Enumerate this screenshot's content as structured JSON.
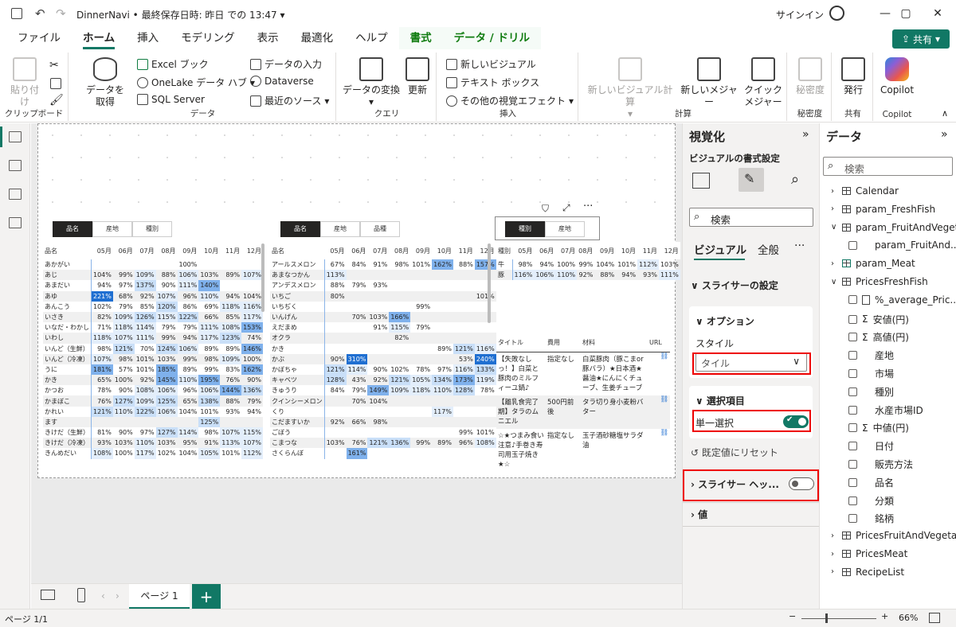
{
  "window": {
    "title": "DinnerNavi • 最終保存日時: 昨日 での 13:47 ▾",
    "signin": "サインイン"
  },
  "tabs": [
    "ファイル",
    "ホーム",
    "挿入",
    "モデリング",
    "表示",
    "最適化",
    "ヘルプ",
    "書式",
    "データ / ドリル"
  ],
  "share": "共有",
  "ribbon": {
    "clipboard": {
      "paste": "貼り付け",
      "label": "クリップボード"
    },
    "data": {
      "get": "データを\n取得",
      "excel": "Excel ブック",
      "onelake": "OneLake データ ハブ",
      "sql": "SQL Server",
      "enter": "データの入力",
      "dataverse": "Dataverse",
      "recent": "最近のソース",
      "label": "データ"
    },
    "query": {
      "transform": "データの変換",
      "refresh": "更新",
      "label": "クエリ"
    },
    "insert": {
      "newvisual": "新しいビジュアル",
      "textbox": "テキスト ボックス",
      "more": "その他の視覚エフェクト",
      "label": "挿入"
    },
    "calc": {
      "visualcalc": "新しいビジュアル計算",
      "newmeasure": "新しいメジャー",
      "quick": "クイック\nメジャー",
      "label": "計算"
    },
    "sensitivity": {
      "btn": "秘密度",
      "label": "秘密度"
    },
    "share": {
      "publish": "発行",
      "label": "共有"
    },
    "copilot": {
      "btn": "Copilot",
      "label": "Copilot"
    }
  },
  "table1": {
    "slicer": [
      "品名",
      "産地",
      "種別"
    ],
    "header": [
      "品名",
      "05月",
      "06月",
      "07月",
      "08月",
      "09月",
      "10月",
      "11月",
      "12月"
    ],
    "rows": [
      [
        "あかがい",
        "",
        "",
        "",
        "",
        "100%",
        "",
        "",
        ""
      ],
      [
        "あじ",
        "104%",
        "99%",
        "109%",
        "88%",
        "106%",
        "103%",
        "89%",
        "107%"
      ],
      [
        "あまだい",
        "94%",
        "97%",
        "137%",
        "90%",
        "111%",
        "140%",
        "",
        ""
      ],
      [
        "あゆ",
        "221%",
        "68%",
        "92%",
        "107%",
        "96%",
        "110%",
        "94%",
        "104%"
      ],
      [
        "あんこう",
        "102%",
        "79%",
        "85%",
        "120%",
        "86%",
        "69%",
        "118%",
        "116%"
      ],
      [
        "いさき",
        "82%",
        "109%",
        "126%",
        "115%",
        "122%",
        "66%",
        "85%",
        "117%"
      ],
      [
        "いなだ・わかし",
        "71%",
        "118%",
        "114%",
        "79%",
        "79%",
        "111%",
        "108%",
        "153%"
      ],
      [
        "いわし",
        "118%",
        "107%",
        "111%",
        "99%",
        "94%",
        "117%",
        "123%",
        "74%"
      ],
      [
        "いんど（生鮮）",
        "98%",
        "121%",
        "70%",
        "124%",
        "106%",
        "89%",
        "89%",
        "146%"
      ],
      [
        "いんど（冷凍）",
        "107%",
        "98%",
        "101%",
        "103%",
        "99%",
        "98%",
        "109%",
        "100%"
      ],
      [
        "うに",
        "181%",
        "57%",
        "101%",
        "185%",
        "89%",
        "99%",
        "83%",
        "162%"
      ],
      [
        "かき",
        "65%",
        "100%",
        "92%",
        "145%",
        "110%",
        "195%",
        "76%",
        "90%"
      ],
      [
        "かつお",
        "78%",
        "90%",
        "108%",
        "106%",
        "96%",
        "106%",
        "144%",
        "136%"
      ],
      [
        "かまぼこ",
        "76%",
        "127%",
        "109%",
        "125%",
        "65%",
        "138%",
        "88%",
        "79%"
      ],
      [
        "かれい",
        "121%",
        "110%",
        "122%",
        "106%",
        "104%",
        "101%",
        "93%",
        "94%"
      ],
      [
        "ます",
        "",
        "",
        "",
        "",
        "",
        "125%",
        "",
        ""
      ],
      [
        "きけだ（生鮮）",
        "81%",
        "90%",
        "97%",
        "127%",
        "114%",
        "98%",
        "107%",
        "115%"
      ],
      [
        "きけだ（冷凍）",
        "93%",
        "103%",
        "110%",
        "103%",
        "95%",
        "91%",
        "113%",
        "107%"
      ],
      [
        "きんめだい",
        "108%",
        "100%",
        "117%",
        "102%",
        "104%",
        "105%",
        "101%",
        "112%"
      ]
    ]
  },
  "table2": {
    "slicer": [
      "品名",
      "産地",
      "品種"
    ],
    "header": [
      "品名",
      "05月",
      "06月",
      "07月",
      "08月",
      "09月",
      "10月",
      "11月",
      "12月"
    ],
    "rows": [
      [
        "アールスメロン",
        "67%",
        "84%",
        "91%",
        "98%",
        "101%",
        "162%",
        "88%",
        "157%"
      ],
      [
        "あまなつかん",
        "113%",
        "",
        "",
        "",
        "",
        "",
        "",
        ""
      ],
      [
        "アンデスメロン",
        "88%",
        "79%",
        "93%",
        "",
        "",
        "",
        "",
        ""
      ],
      [
        "いちご",
        "80%",
        "",
        "",
        "",
        "",
        "",
        "",
        "101%"
      ],
      [
        "いちぢく",
        "",
        "",
        "",
        "",
        "99%",
        "",
        "",
        ""
      ],
      [
        "いんげん",
        "",
        "70%",
        "103%",
        "166%",
        "",
        "",
        "",
        ""
      ],
      [
        "えだまめ",
        "",
        "",
        "91%",
        "115%",
        "79%",
        "",
        "",
        ""
      ],
      [
        "オクラ",
        "",
        "",
        "",
        "82%",
        "",
        "",
        "",
        ""
      ],
      [
        "かき",
        "",
        "",
        "",
        "",
        "",
        "89%",
        "121%",
        "116%"
      ],
      [
        "かぶ",
        "90%",
        "310%",
        "",
        "",
        "",
        "",
        "53%",
        "240%"
      ],
      [
        "かぼちゃ",
        "121%",
        "114%",
        "90%",
        "102%",
        "78%",
        "97%",
        "116%",
        "133%"
      ],
      [
        "キャベツ",
        "128%",
        "43%",
        "92%",
        "121%",
        "105%",
        "134%",
        "173%",
        "119%"
      ],
      [
        "きゅうり",
        "84%",
        "79%",
        "149%",
        "109%",
        "118%",
        "110%",
        "128%",
        "78%"
      ],
      [
        "クインシーメロン",
        "",
        "70%",
        "104%",
        "",
        "",
        "",
        "",
        ""
      ],
      [
        "くり",
        "",
        "",
        "",
        "",
        "",
        "117%",
        "",
        ""
      ],
      [
        "こだますいか",
        "92%",
        "66%",
        "98%",
        "",
        "",
        "",
        "",
        ""
      ],
      [
        "ごぼう",
        "",
        "",
        "",
        "",
        "",
        "",
        "99%",
        "101%"
      ],
      [
        "こまつな",
        "103%",
        "76%",
        "121%",
        "136%",
        "99%",
        "89%",
        "96%",
        "108%"
      ],
      [
        "さくらんぼ",
        "",
        "161%",
        "",
        "",
        "",
        "",
        "",
        ""
      ]
    ]
  },
  "table3": {
    "slicer": [
      "種別",
      "産地"
    ],
    "header": [
      "種別",
      "05月",
      "06月",
      "07月",
      "08月",
      "09月",
      "10月",
      "11月",
      "12月"
    ],
    "rows": [
      [
        "牛",
        "98%",
        "94%",
        "100%",
        "99%",
        "104%",
        "101%",
        "112%",
        "103%"
      ],
      [
        "豚",
        "116%",
        "106%",
        "110%",
        "92%",
        "88%",
        "94%",
        "93%",
        "111%"
      ]
    ]
  },
  "recipes": {
    "header": [
      "タイトル",
      "費用",
      "材料",
      "URL"
    ],
    "rows": [
      [
        "【失敗なしっ！】白菜と豚肉のミルフィーユ鍋♪",
        "指定なし",
        "白菜豚肉（豚こまor豚バラ）★日本酒★醤油★にんにくチューブ、生姜チューブ"
      ],
      [
        "【離乳食完了期】タラのムニエル",
        "500円前後",
        "タラ切り身小麦粉バター"
      ],
      [
        "☆★つまみ食い注意♪手巻き寿司用玉子焼き★☆",
        "指定なし",
        "玉子酒砂糖塩サラダ油"
      ]
    ]
  },
  "visual_header_icons": [
    "filter-icon",
    "focus-mode-icon",
    "more-options-icon"
  ],
  "viz_pane": {
    "title": "視覚化",
    "subtitle": "ビジュアルの書式設定",
    "search": "検索",
    "tab_visual": "ビジュアル",
    "tab_general": "全般",
    "slicer_settings": "スライサーの設定",
    "options": "オプション",
    "style_label": "スタイル",
    "style_value": "タイル",
    "selection": "選択項目",
    "single_select": "単一選択",
    "reset": "既定値にリセット",
    "slicer_header": "スライサー ヘッ...",
    "values": "値"
  },
  "data_pane": {
    "title": "データ",
    "search": "検索",
    "items": [
      {
        "label": "Calendar",
        "type": "table",
        "indent": 0
      },
      {
        "label": "param_FreshFish",
        "type": "table",
        "indent": 0
      },
      {
        "label": "param_FruitAndVeget...",
        "type": "table",
        "indent": 0,
        "open": true
      },
      {
        "label": "param_FruitAnd...",
        "type": "field",
        "indent": 1
      },
      {
        "label": "param_Meat",
        "type": "table-checked",
        "indent": 0
      },
      {
        "label": "PricesFreshFish",
        "type": "table",
        "indent": 0,
        "open": true
      },
      {
        "label": "%_average_Pric...",
        "type": "measure",
        "indent": 1
      },
      {
        "label": "安値(円)",
        "type": "sigma",
        "indent": 1
      },
      {
        "label": "高値(円)",
        "type": "sigma",
        "indent": 1
      },
      {
        "label": "産地",
        "type": "field",
        "indent": 1
      },
      {
        "label": "市場",
        "type": "field",
        "indent": 1
      },
      {
        "label": "種別",
        "type": "field",
        "indent": 1
      },
      {
        "label": "水産市場ID",
        "type": "field",
        "indent": 1
      },
      {
        "label": "中値(円)",
        "type": "sigma",
        "indent": 1
      },
      {
        "label": "日付",
        "type": "field",
        "indent": 1
      },
      {
        "label": "販売方法",
        "type": "field",
        "indent": 1
      },
      {
        "label": "品名",
        "type": "field",
        "indent": 1
      },
      {
        "label": "分類",
        "type": "field",
        "indent": 1
      },
      {
        "label": "銘柄",
        "type": "field",
        "indent": 1
      },
      {
        "label": "PricesFruitAndVegeta...",
        "type": "table",
        "indent": 0
      },
      {
        "label": "PricesMeat",
        "type": "table",
        "indent": 0
      },
      {
        "label": "RecipeList",
        "type": "table",
        "indent": 0
      }
    ]
  },
  "bottom": {
    "page": "ページ 1",
    "add": "+"
  },
  "status": {
    "page": "ページ 1/1",
    "zoom": "66%"
  },
  "colors": {
    "accent": "#117865",
    "highlight": "#e00000"
  }
}
